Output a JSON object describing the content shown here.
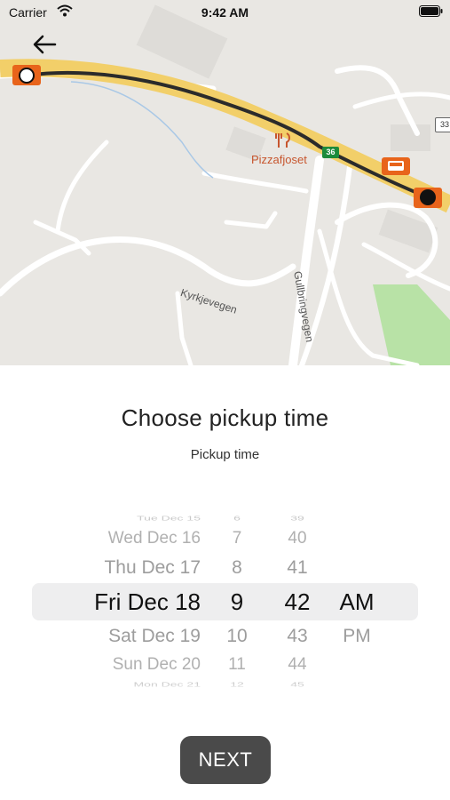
{
  "status_bar": {
    "carrier": "Carrier",
    "time": "9:42 AM"
  },
  "map": {
    "labels": {
      "poi": "Pizzafjoset",
      "road_shield": "36",
      "road_shield_2": "33",
      "street_1": "Kyrkjevegen",
      "street_2": "Gullbringvegen"
    }
  },
  "title": "Choose pickup time",
  "subtitle": "Pickup time",
  "picker": {
    "day": {
      "above": [
        "Tue Dec 15",
        "Wed Dec 16",
        "Thu Dec 17"
      ],
      "selected": "Fri Dec 18",
      "below": [
        "Sat Dec 19",
        "Sun Dec 20",
        "Mon Dec 21"
      ]
    },
    "hour": {
      "above": [
        "6",
        "7",
        "8"
      ],
      "selected": "9",
      "below": [
        "10",
        "11",
        "12"
      ]
    },
    "minute": {
      "above": [
        "39",
        "40",
        "41"
      ],
      "selected": "42",
      "below": [
        "43",
        "44",
        "45"
      ]
    },
    "ampm": {
      "selected": "AM",
      "below": [
        "PM"
      ]
    }
  },
  "next_button": {
    "label": "NEXT"
  },
  "colors": {
    "route": "#2b2b2b",
    "highway": "#f2cf69",
    "marker": "#e8641b",
    "button": "#4a4a4a"
  }
}
